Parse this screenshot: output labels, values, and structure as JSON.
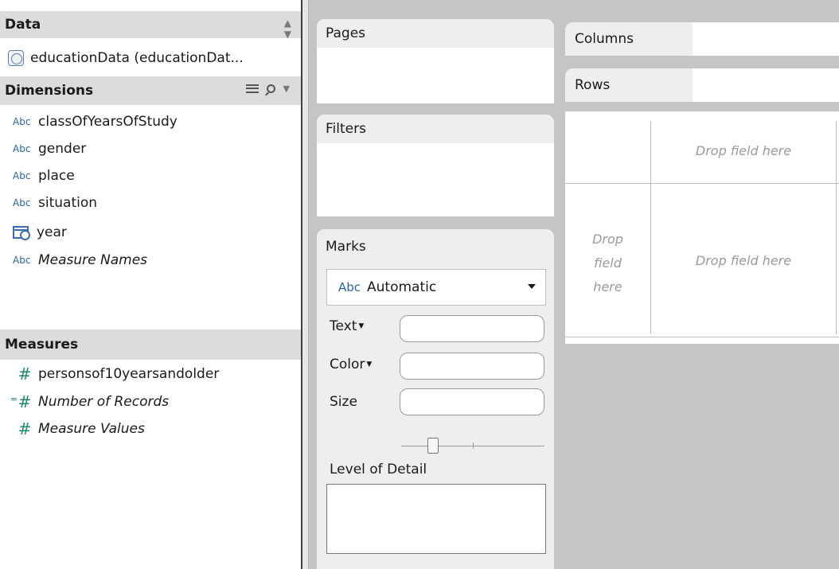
{
  "data_pane": {
    "title": "Data",
    "sort_icon": "up-down-arrows-icon",
    "source": "educationData (educationDat...",
    "dimensions_title": "Dimensions",
    "dimensions": [
      {
        "type_badge": "Abc",
        "label": "classOfYearsOfStudy"
      },
      {
        "type_badge": "Abc",
        "label": "gender"
      },
      {
        "type_badge": "Abc",
        "label": "place"
      },
      {
        "type_badge": "Abc",
        "label": "situation"
      },
      {
        "type_badge": "",
        "label": "year",
        "icon": "calendar-icon"
      },
      {
        "type_badge": "Abc",
        "label": "Measure Names"
      }
    ],
    "measures_title": "Measures",
    "measures": [
      {
        "symbol": "#",
        "label": "personsof10yearsandolder"
      },
      {
        "symbol": "#",
        "label": "Number of Records",
        "calculated": true
      },
      {
        "symbol": "#",
        "label": "Measure Values"
      }
    ]
  },
  "cards": {
    "pages": "Pages",
    "filters": "Filters",
    "marks": "Marks",
    "mark_type_badge": "Abc",
    "mark_type": "Automatic",
    "text_label": "Text",
    "color_label": "Color",
    "size_label": "Size",
    "size_slider_level": 0.2,
    "level_of_detail": "Level of Detail"
  },
  "shelves": {
    "columns": "Columns",
    "rows": "Rows"
  },
  "viz": {
    "drop_columns": "Drop field here",
    "drop_rows_line1": "Drop",
    "drop_rows_line2": "field",
    "drop_rows_line3": "here",
    "drop_body": "Drop field here"
  },
  "colors": {
    "dimension_badge": "#2a64a8",
    "measure_hash": "#1f8a5e",
    "workspace_bg": "#c5c5c5"
  }
}
